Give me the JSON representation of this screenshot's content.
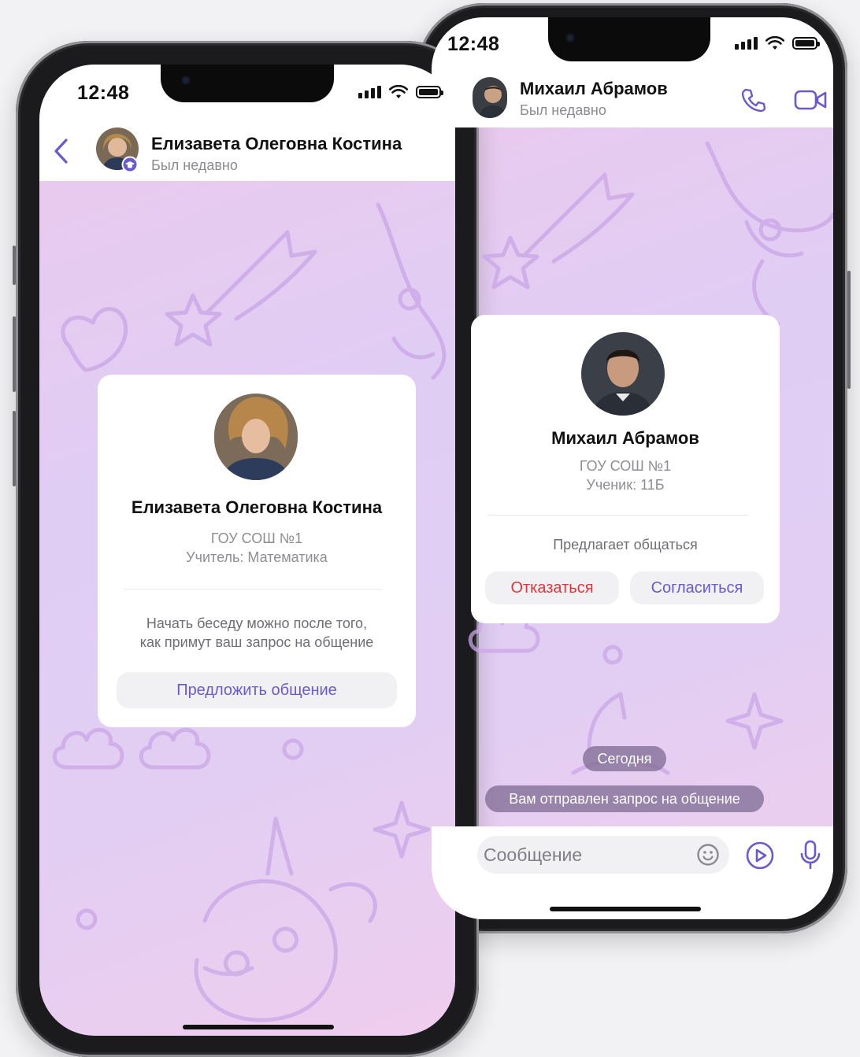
{
  "colors": {
    "accent": "#6a5acd",
    "danger": "#e0343a",
    "muted": "#8d8d93"
  },
  "back_phone": {
    "status": {
      "time": "12:48"
    },
    "header": {
      "name": "Михаил Абрамов",
      "status": "Был недавно",
      "icons": [
        "phone-icon",
        "video-call-icon"
      ]
    },
    "card": {
      "name": "Михаил Абрамов",
      "school": "ГОУ СОШ №1",
      "role": "Ученик: 11Б",
      "prompt": "Предлагает общаться",
      "decline_label": "Отказаться",
      "accept_label": "Согласиться"
    },
    "date_pill": "Сегодня",
    "system_message": "Вам отправлен запрос на общение",
    "composer": {
      "placeholder": "Сообщение",
      "icons": [
        "emoji-icon",
        "send-play-icon",
        "microphone-icon"
      ]
    }
  },
  "front_phone": {
    "status": {
      "time": "12:48"
    },
    "header": {
      "name": "Елизавета Олеговна Костина",
      "status": "Был недавно",
      "icons": [
        "back-chevron-icon",
        "teacher-badge-icon"
      ]
    },
    "card": {
      "name": "Елизавета Олеговна Костина",
      "school": "ГОУ СОШ №1",
      "role": "Учитель: Математика",
      "info_line1": "Начать беседу можно после того,",
      "info_line2": "как примут ваш запрос на общение",
      "action_label": "Предложить общение"
    }
  }
}
